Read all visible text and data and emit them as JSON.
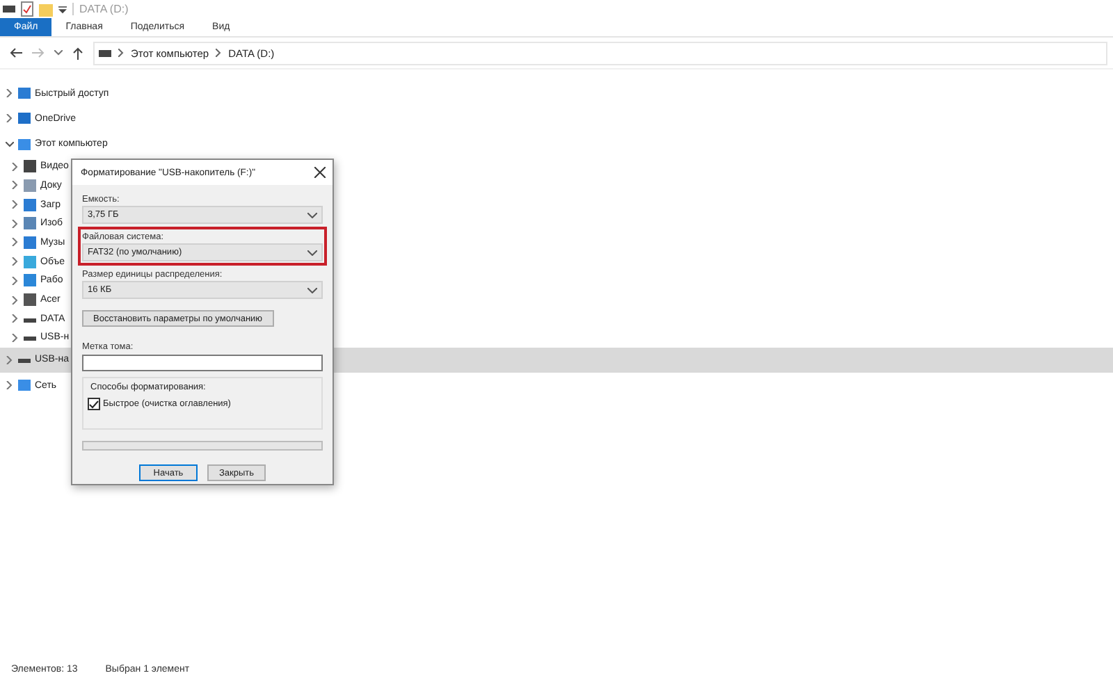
{
  "window": {
    "title": "DATA (D:)"
  },
  "ribbon": [
    {
      "label": "Файл",
      "kind": "file"
    },
    {
      "label": "Главная",
      "kind": "tab"
    },
    {
      "label": "Поделиться",
      "kind": "tab"
    },
    {
      "label": "Вид",
      "kind": "tab"
    }
  ],
  "address": {
    "crumbs": [
      "Этот компьютер",
      "DATA (D:)"
    ]
  },
  "tree": [
    {
      "label": "Быстрый доступ",
      "kind": "star",
      "selected": false,
      "expanded": false
    },
    {
      "label": "OneDrive",
      "kind": "cloud",
      "selected": false,
      "expanded": false
    },
    {
      "label": "Этот компьютер",
      "kind": "pc",
      "selected": false,
      "expanded": true,
      "children": [
        {
          "label": "Видео",
          "kind": "video",
          "selected": false,
          "expanded": false
        },
        {
          "label": "Доку",
          "kind": "docs",
          "selected": false,
          "expanded": false
        },
        {
          "label": "Загр",
          "kind": "download",
          "selected": false,
          "expanded": false
        },
        {
          "label": "Изоб",
          "kind": "images",
          "selected": false,
          "expanded": false
        },
        {
          "label": "Музы",
          "kind": "music",
          "selected": false,
          "expanded": false
        },
        {
          "label": "Объе",
          "kind": "objects",
          "selected": false,
          "expanded": false
        },
        {
          "label": "Рабо",
          "kind": "desktop",
          "selected": false,
          "expanded": false
        },
        {
          "label": "Acer",
          "kind": "sysdrive",
          "selected": false,
          "expanded": false
        },
        {
          "label": "DATA",
          "kind": "drive",
          "selected": false,
          "expanded": false
        },
        {
          "label": "USB-н",
          "kind": "drive",
          "selected": false,
          "expanded": false
        }
      ]
    },
    {
      "label": "USB-на",
      "kind": "drive",
      "selected": true,
      "expanded": false
    },
    {
      "label": "Сеть",
      "kind": "network",
      "selected": false,
      "expanded": false
    }
  ],
  "status_bar": [
    "Элементов: 13",
    "Выбран 1 элемент"
  ],
  "dialog": {
    "title": "Форматирование \"USB-накопитель (F:)\"",
    "selects": [
      {
        "label": "Емкость:",
        "value": "3,75 ГБ",
        "highlighted": false
      },
      {
        "label": "Файловая система:",
        "value": "FAT32 (по умолчанию)",
        "highlighted": true
      },
      {
        "label": "Размер единицы распределения:",
        "value": "16 КБ",
        "highlighted": false
      }
    ],
    "restore_button": "Восстановить параметры по умолчанию",
    "volume_label": {
      "label": "Метка тома:"
    },
    "options": {
      "title": "Способы форматирования:",
      "quick": {
        "label": "Быстрое (очистка оглавления)",
        "checked": true
      }
    },
    "progress": {
      "level": 0
    },
    "buttons": [
      {
        "label": "Начать",
        "default": true
      },
      {
        "label": "Закрыть",
        "default": false
      }
    ]
  }
}
